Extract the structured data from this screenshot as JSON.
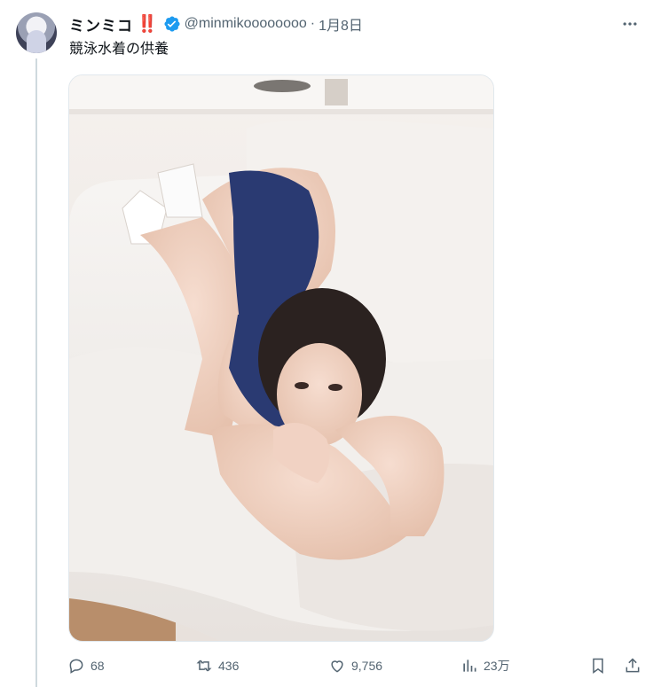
{
  "post": {
    "author": {
      "display_name": "ミンミコ",
      "emoji": "‼️",
      "handle": "@minmikoooooooo",
      "verified": true
    },
    "separator": "·",
    "date": "1月8日",
    "text": "競泳水着の供養",
    "media": {
      "kind": "photo",
      "description_icon": "photo"
    },
    "actions": {
      "replies": "68",
      "reposts": "436",
      "likes": "9,756",
      "views": "23万"
    }
  },
  "colors": {
    "text_primary": "#0f1419",
    "text_secondary": "#536471",
    "verified_blue": "#1d9bf0",
    "thread_line": "#cfd9de"
  }
}
